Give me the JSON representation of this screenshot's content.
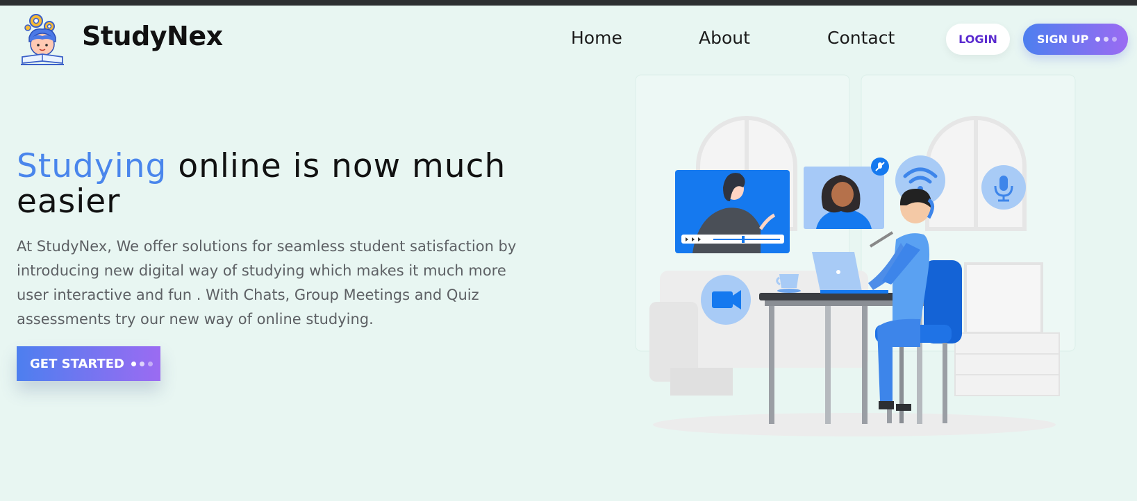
{
  "brand": {
    "name": "StudyNex"
  },
  "nav": {
    "home": "Home",
    "about": "About",
    "contact": "Contact",
    "login": "LOGIN",
    "signup": "SIGN UP"
  },
  "hero": {
    "title_accent": "Studying",
    "title_rest": " online is now much easier",
    "description": "At StudyNex, We offer solutions for seamless student satisfaction by introducing new digital way of studying which makes it much more user interactive and fun . With Chats, Group Meetings and Quiz assessments try our new way of online studying.",
    "cta": "GET STARTED"
  },
  "colors": {
    "background": "#e8f6f2",
    "accent": "#4a86ec",
    "gradient_start": "#4d7fef",
    "gradient_end": "#9b6bf2",
    "login_text": "#5b2ccf"
  },
  "icons": {
    "logo": "student-with-gears-logo",
    "wifi": "wifi-icon",
    "microphone": "microphone-icon",
    "video": "video-camera-icon",
    "muted": "mic-off-icon"
  }
}
